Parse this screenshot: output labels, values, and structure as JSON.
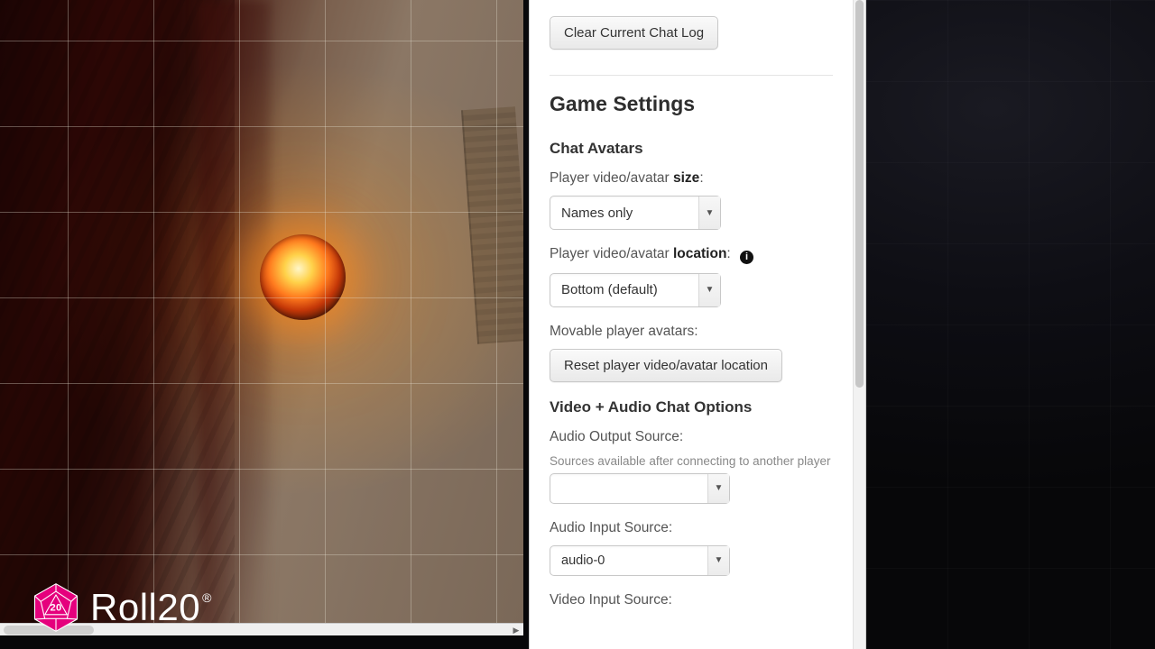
{
  "logo": {
    "text": "Roll20",
    "die_number": "20",
    "brand_color": "#e5007d",
    "trademark": "®"
  },
  "map": {
    "token": "fireball-token",
    "grid": true
  },
  "panel": {
    "clear_chat_button": "Clear Current Chat Log",
    "heading": "Game Settings",
    "chat_avatars": {
      "section_title": "Chat Avatars",
      "size_label_prefix": "Player video/avatar ",
      "size_label_strong": "size",
      "size_label_suffix": ":",
      "size_value": "Names only",
      "location_label_prefix": "Player video/avatar ",
      "location_label_strong": "location",
      "location_label_suffix": ":",
      "location_value": "Bottom (default)",
      "movable_label": "Movable player avatars:",
      "reset_button": "Reset player video/avatar location"
    },
    "av": {
      "section_title": "Video + Audio Chat Options",
      "audio_out_label": "Audio Output Source:",
      "audio_out_note": "Sources available after connecting to another player",
      "audio_out_value": "",
      "audio_in_label": "Audio Input Source:",
      "audio_in_value": "audio-0",
      "video_in_label": "Video Input Source:"
    }
  }
}
